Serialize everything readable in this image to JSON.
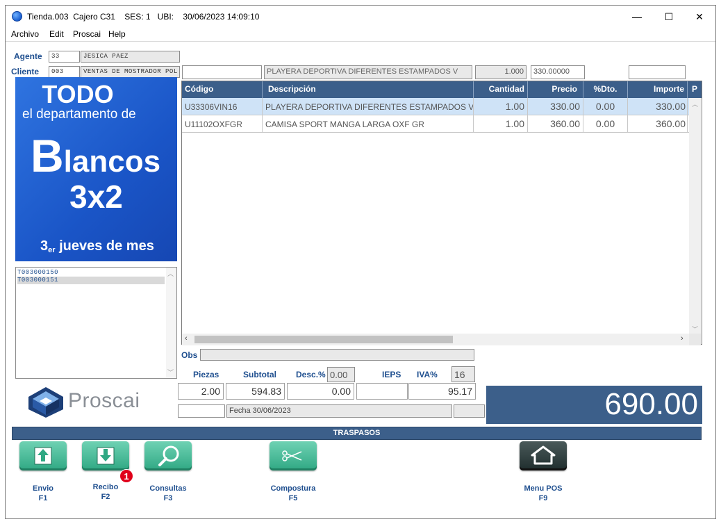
{
  "window": {
    "title": "Tienda.003  Cajero C31    SES: 1   UBI:    30/06/2023 14:09:10",
    "minimize_glyph": "—",
    "maximize_glyph": "☐",
    "close_glyph": "✕"
  },
  "menu": [
    "Archivo",
    "Edit",
    "Proscai",
    "Help"
  ],
  "agent": {
    "label": "Agente",
    "code": "33",
    "name": "JESICA PAEZ"
  },
  "client": {
    "label": "Cliente",
    "code": "003",
    "name": "VENTAS DE MOSTRADOR POL"
  },
  "entry": {
    "code": "",
    "description": "PLAYERA DEPORTIVA DIFERENTES ESTAMPADOS V",
    "quantity": "1.000",
    "price": "330.00000",
    "extra": ""
  },
  "promo": {
    "line1": "TODO",
    "line2": "el departamento de",
    "line3_big": "B",
    "line3_rest": "lancos",
    "line4": "3x2",
    "line5_num": "3",
    "line5_sup": "er",
    "line5_rest": " jueves de mes"
  },
  "tickets": [
    "T003000150",
    "T003000151"
  ],
  "grid": {
    "headers": [
      "Código",
      "Descripción",
      "Cantidad",
      "Precio",
      "%Dto.",
      "Importe",
      "P"
    ],
    "rows": [
      [
        "U33306VIN16",
        "PLAYERA DEPORTIVA DIFERENTES ESTAMPADOS VI",
        "1.00",
        "330.00",
        "0.00",
        "330.00"
      ],
      [
        "U11102OXFGR",
        "CAMISA SPORT MANGA LARGA OXF GR",
        "1.00",
        "360.00",
        "0.00",
        "360.00"
      ]
    ]
  },
  "obs": {
    "label": "Obs",
    "value": ""
  },
  "totals": {
    "piezas_label": "Piezas",
    "subtotal_label": "Subtotal",
    "desc_label": "Desc.%",
    "desc_pct": "0.00",
    "ieps_label": "IEPS",
    "iva_label": "IVA%",
    "iva_pct": "16",
    "piezas": "2.00",
    "subtotal": "594.83",
    "desc_amount": "0.00",
    "ieps": "",
    "iva": "95.17",
    "fecha": "Fecha 30/06/2023",
    "grand_total": "690.00"
  },
  "brand": {
    "name": "Proscai"
  },
  "section_title": "TRASPASOS",
  "functions": [
    {
      "label": "Envio",
      "key": "F1"
    },
    {
      "label": "Recibo",
      "key": "F2",
      "badge": "1"
    },
    {
      "label": "Consultas",
      "key": "F3"
    },
    {
      "label": "Compostura",
      "key": "F5"
    },
    {
      "label": "Menu POS",
      "key": "F9"
    }
  ],
  "colors": {
    "accent": "#3c5f8a",
    "selected_row": "#cfe3f7",
    "button_green": "#2fa883",
    "badge": "#e0001a"
  }
}
